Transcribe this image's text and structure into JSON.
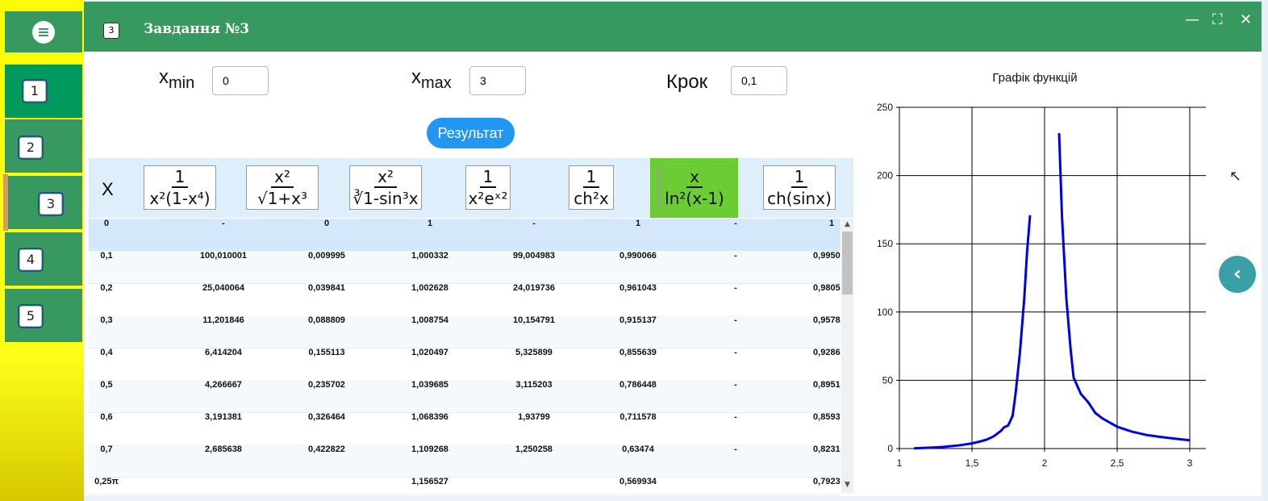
{
  "window": {
    "title": "Завдання №3",
    "badge": "3"
  },
  "sidebar": {
    "items": [
      {
        "label": "1"
      },
      {
        "label": "2"
      },
      {
        "label": "3"
      },
      {
        "label": "4"
      },
      {
        "label": "5"
      }
    ],
    "active": "3"
  },
  "controls": {
    "xmin": {
      "label": "x",
      "sub": "min",
      "value": "0"
    },
    "xmax": {
      "label": "x",
      "sub": "max",
      "value": "3"
    },
    "step": {
      "label": "Крок",
      "value": "0,1"
    },
    "result_button": "Результат"
  },
  "table": {
    "x_header": "X",
    "columns": [
      {
        "num": "1",
        "den": "x²(1-x⁴)"
      },
      {
        "num": "x²",
        "den": "√1+x³"
      },
      {
        "num": "x²",
        "den": "∛1-sin³x"
      },
      {
        "num": "1",
        "den": "x²eˣ²"
      },
      {
        "num": "1",
        "den": "ch²x"
      },
      {
        "num": "x",
        "den": "ln²(x-1)",
        "highlighted": true
      },
      {
        "num": "1",
        "den": "ch(sinx)"
      }
    ],
    "rows": [
      [
        "0",
        "-",
        "0",
        "1",
        "-",
        "1",
        "-",
        "1"
      ],
      [
        "0,1",
        "100,010001",
        "0,009995",
        "1,000332",
        "99,004983",
        "0,990066",
        "-",
        "0,995037"
      ],
      [
        "0,2",
        "25,040064",
        "0,039841",
        "1,002628",
        "24,019736",
        "0,961043",
        "-",
        "0,980585"
      ],
      [
        "0,3",
        "11,201846",
        "0,088809",
        "1,008754",
        "10,154791",
        "0,915137",
        "-",
        "0,957868"
      ],
      [
        "0,4",
        "6,414204",
        "0,155113",
        "1,020497",
        "5,325899",
        "0,855639",
        "-",
        "0,928689"
      ],
      [
        "0,5",
        "4,266667",
        "0,235702",
        "1,039685",
        "3,115203",
        "0,786448",
        "-",
        "0,895141"
      ],
      [
        "0,6",
        "3,191381",
        "0,326464",
        "1,068396",
        "1,93799",
        "0,711578",
        "-",
        "0,859335"
      ],
      [
        "0,7",
        "2,685638",
        "0,422822",
        "1,109268",
        "1,250258",
        "0,63474",
        "-",
        "0,823191"
      ],
      [
        "0,25π",
        "",
        "",
        "1,156527",
        "",
        "0,569934",
        "",
        "0,792378"
      ]
    ]
  },
  "chart_data": {
    "type": "line",
    "title": "Графік функцій",
    "xlim": [
      1,
      3
    ],
    "ylim": [
      0,
      250
    ],
    "xticks": [
      "1",
      "1,5",
      "2",
      "2,5",
      "3"
    ],
    "yticks": [
      "0",
      "50",
      "100",
      "150",
      "200",
      "250"
    ],
    "grid": true,
    "line_color": "#0000e6",
    "series": [
      {
        "segments": [
          [
            [
              1.1,
              0.2
            ],
            [
              1.2,
              0.6
            ],
            [
              1.3,
              1.2
            ],
            [
              1.4,
              2.2
            ],
            [
              1.5,
              3.8
            ],
            [
              1.55,
              5
            ],
            [
              1.6,
              6.5
            ],
            [
              1.65,
              9
            ],
            [
              1.7,
              13
            ],
            [
              1.72,
              15.5
            ],
            [
              1.75,
              17
            ],
            [
              1.78,
              24
            ],
            [
              1.8,
              40
            ],
            [
              1.83,
              70
            ],
            [
              1.86,
              110
            ],
            [
              1.88,
              145
            ],
            [
              1.9,
              171
            ]
          ],
          [
            [
              2.1,
              231
            ],
            [
              2.12,
              170
            ],
            [
              2.15,
              110
            ],
            [
              2.18,
              72
            ],
            [
              2.2,
              52
            ],
            [
              2.25,
              40
            ],
            [
              2.3,
              34
            ],
            [
              2.35,
              26
            ],
            [
              2.4,
              22
            ],
            [
              2.5,
              16
            ],
            [
              2.6,
              12.5
            ],
            [
              2.7,
              10
            ],
            [
              2.8,
              8.5
            ],
            [
              2.9,
              7.2
            ],
            [
              3.0,
              6
            ]
          ]
        ]
      }
    ]
  }
}
